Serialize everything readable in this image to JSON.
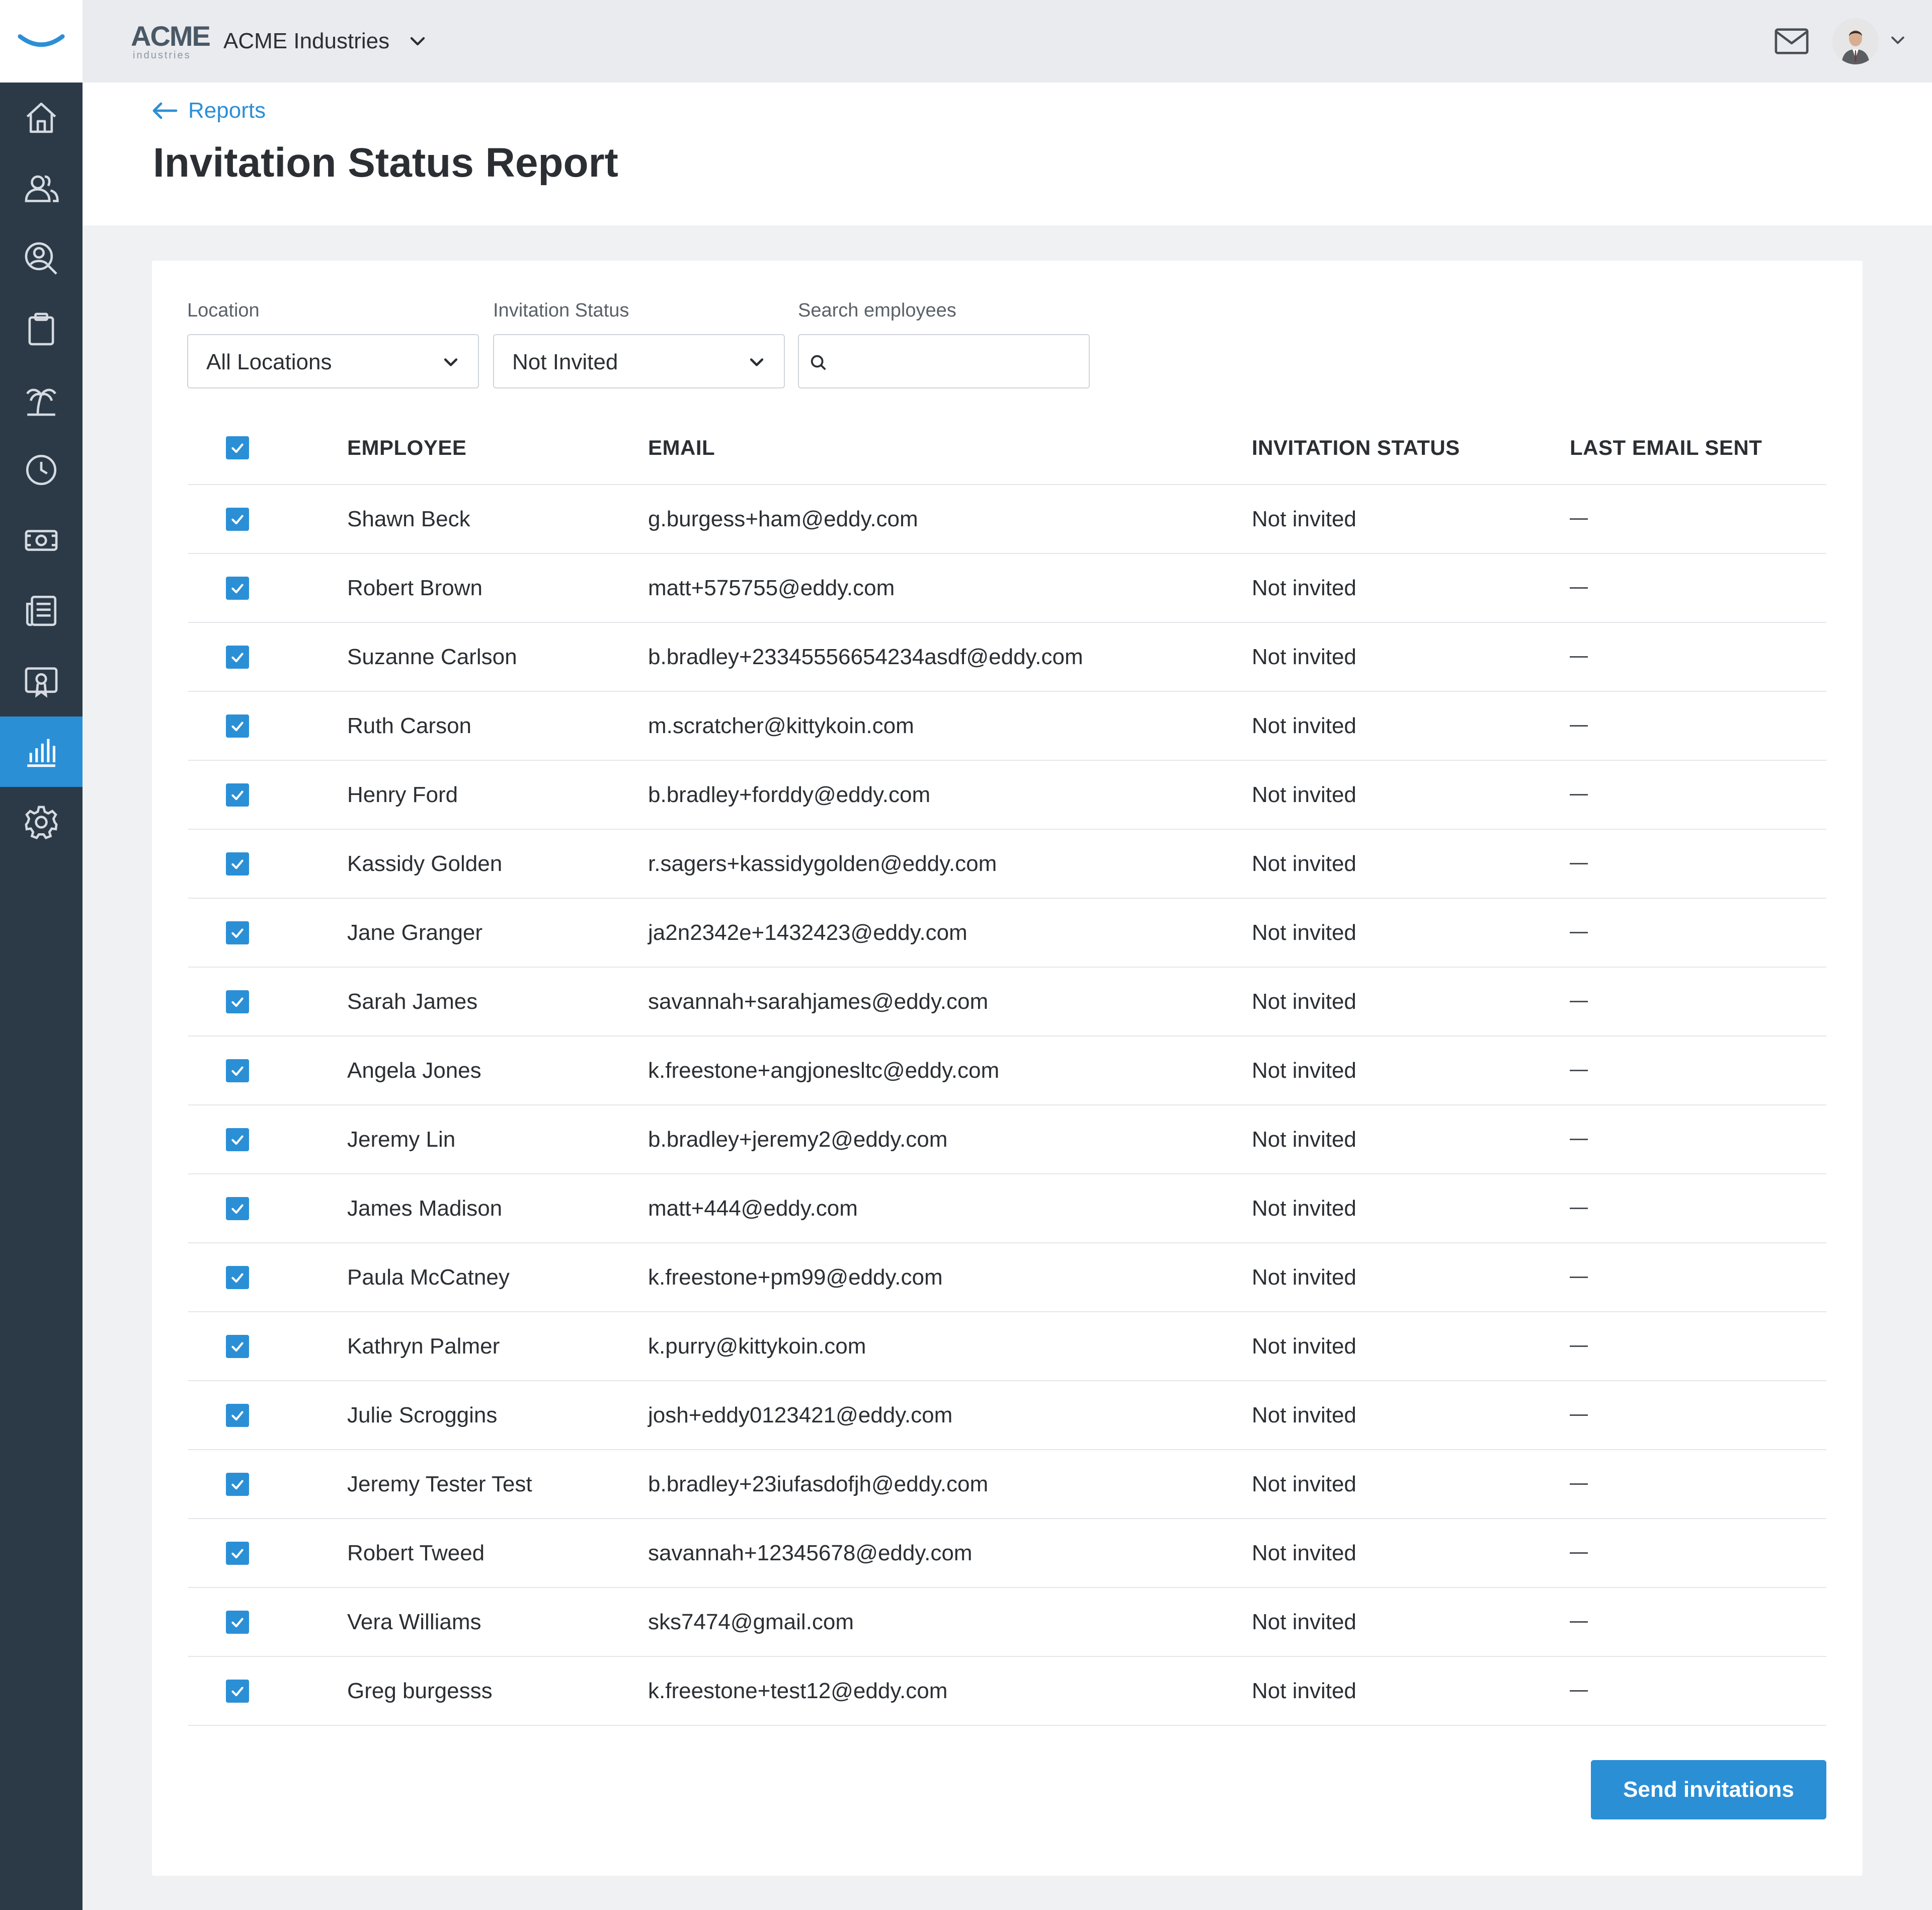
{
  "app": {
    "brand_color": "#2b8fd6",
    "sidebar_color": "#2c3a48"
  },
  "sidebar": {
    "logo_icon": "smile-logo-icon",
    "items": [
      {
        "icon": "home-icon",
        "active": false
      },
      {
        "icon": "people-icon",
        "active": false
      },
      {
        "icon": "person-search-icon",
        "active": false
      },
      {
        "icon": "clipboard-icon",
        "active": false
      },
      {
        "icon": "palm-tree-icon",
        "active": false
      },
      {
        "icon": "clock-icon",
        "active": false
      },
      {
        "icon": "money-icon",
        "active": false
      },
      {
        "icon": "newspaper-icon",
        "active": false
      },
      {
        "icon": "certificate-icon",
        "active": false
      },
      {
        "icon": "bar-chart-icon",
        "active": true
      },
      {
        "icon": "gear-icon",
        "active": false
      }
    ]
  },
  "topbar": {
    "logo_text": "ACME",
    "logo_subtext": "industries",
    "company_name": "ACME Industries",
    "mail_icon": "mail-icon",
    "avatar_icon": "user-avatar"
  },
  "header": {
    "back_label": "Reports",
    "title": "Invitation Status Report"
  },
  "filters": {
    "location_label": "Location",
    "location_value": "All Locations",
    "status_label": "Invitation Status",
    "status_value": "Not Invited",
    "search_label": "Search employees",
    "search_value": "",
    "search_placeholder": ""
  },
  "table": {
    "header_checked": true,
    "columns": [
      "EMPLOYEE",
      "EMAIL",
      "INVITATION STATUS",
      "LAST EMAIL SENT"
    ],
    "rows": [
      {
        "checked": true,
        "employee": "Shawn Beck",
        "email": "g.burgess+ham@eddy.com",
        "status": "Not invited",
        "last_sent": ""
      },
      {
        "checked": true,
        "employee": "Robert Brown",
        "email": "matt+575755@eddy.com",
        "status": "Not invited",
        "last_sent": ""
      },
      {
        "checked": true,
        "employee": "Suzanne Carlson",
        "email": "b.bradley+23345556654234asdf@eddy.com",
        "status": "Not invited",
        "last_sent": ""
      },
      {
        "checked": true,
        "employee": "Ruth Carson",
        "email": "m.scratcher@kittykoin.com",
        "status": "Not invited",
        "last_sent": ""
      },
      {
        "checked": true,
        "employee": "Henry Ford",
        "email": "b.bradley+forddy@eddy.com",
        "status": "Not invited",
        "last_sent": ""
      },
      {
        "checked": true,
        "employee": "Kassidy Golden",
        "email": "r.sagers+kassidygolden@eddy.com",
        "status": "Not invited",
        "last_sent": ""
      },
      {
        "checked": true,
        "employee": "Jane Granger",
        "email": "ja2n2342e+1432423@eddy.com",
        "status": "Not invited",
        "last_sent": ""
      },
      {
        "checked": true,
        "employee": "Sarah James",
        "email": "savannah+sarahjames@eddy.com",
        "status": "Not invited",
        "last_sent": ""
      },
      {
        "checked": true,
        "employee": "Angela Jones",
        "email": "k.freestone+angjonesltc@eddy.com",
        "status": "Not invited",
        "last_sent": ""
      },
      {
        "checked": true,
        "employee": "Jeremy Lin",
        "email": "b.bradley+jeremy2@eddy.com",
        "status": "Not invited",
        "last_sent": ""
      },
      {
        "checked": true,
        "employee": "James Madison",
        "email": "matt+444@eddy.com",
        "status": "Not invited",
        "last_sent": ""
      },
      {
        "checked": true,
        "employee": "Paula McCatney",
        "email": "k.freestone+pm99@eddy.com",
        "status": "Not invited",
        "last_sent": ""
      },
      {
        "checked": true,
        "employee": "Kathryn Palmer",
        "email": "k.purry@kittykoin.com",
        "status": "Not invited",
        "last_sent": ""
      },
      {
        "checked": true,
        "employee": "Julie Scroggins",
        "email": "josh+eddy0123421@eddy.com",
        "status": "Not invited",
        "last_sent": ""
      },
      {
        "checked": true,
        "employee": "Jeremy Tester Test",
        "email": "b.bradley+23iufasdofjh@eddy.com",
        "status": "Not invited",
        "last_sent": ""
      },
      {
        "checked": true,
        "employee": "Robert Tweed",
        "email": "savannah+12345678@eddy.com",
        "status": "Not invited",
        "last_sent": ""
      },
      {
        "checked": true,
        "employee": "Vera Williams",
        "email": "sks7474@gmail.com",
        "status": "Not invited",
        "last_sent": ""
      },
      {
        "checked": true,
        "employee": "Greg burgesss",
        "email": "k.freestone+test12@eddy.com",
        "status": "Not invited",
        "last_sent": ""
      }
    ]
  },
  "actions": {
    "send_label": "Send invitations"
  }
}
